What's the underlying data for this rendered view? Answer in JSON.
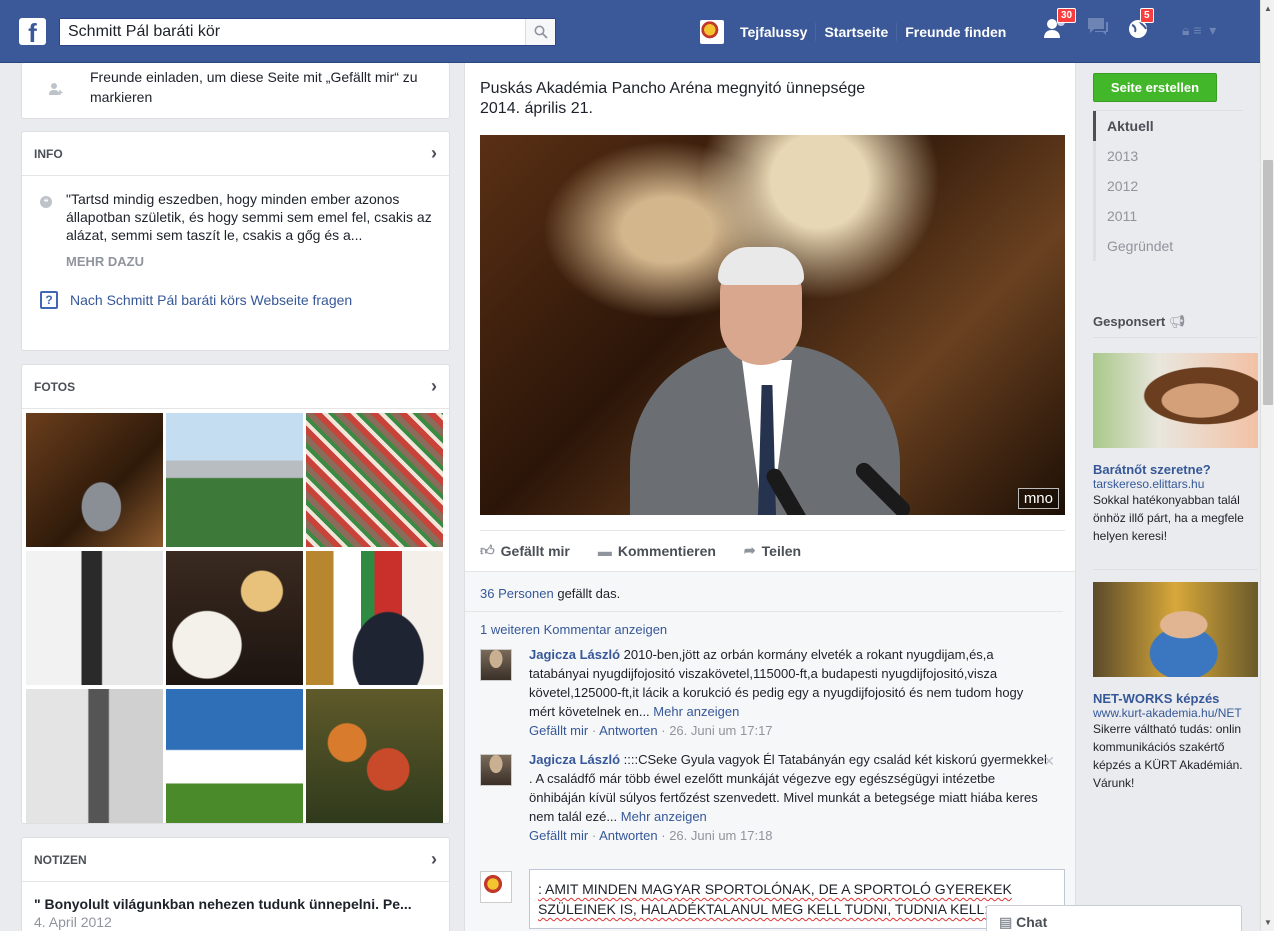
{
  "topbar": {
    "logo": "f",
    "search_value": "Schmitt Pál baráti kör",
    "user_name": "Tejfalussy",
    "nav": [
      "Startseite",
      "Freunde finden"
    ],
    "friend_requests_count": "30",
    "notifications_count": "5"
  },
  "invite": {
    "text": "Freunde einladen, um diese Seite mit „Gefällt mir“ zu markieren"
  },
  "info": {
    "header": "INFO",
    "quote": "\"Tartsd mindig eszedben, hogy minden ember azonos állapotban születik, és hogy semmi sem emel fel, csakis az alázat, semmi sem taszít le, csakis a gőg és a...",
    "more": "MEHR DAZU",
    "ask": "Nach Schmitt Pál baráti körs Webseite fragen"
  },
  "fotos": {
    "header": "FOTOS"
  },
  "notizen": {
    "header": "NOTIZEN",
    "title": "\" Bonyolult világunkban nehezen tudunk ünnepelni. Pe...",
    "date": "4. April 2012"
  },
  "post": {
    "text_line1": "Puskás Akadémia Pancho Aréna megnyitó ünnepsége",
    "text_line2": "2014. április 21.",
    "watermark": "mno",
    "actions": [
      "Gefällt mir",
      "Kommentieren",
      "Teilen"
    ],
    "likes_count": "36 Personen",
    "likes_suffix": " gefällt das.",
    "more_comments": "1 weiteren Kommentar anzeigen",
    "comments": [
      {
        "author": "Jagicza László",
        "text": " 2010-ben,jött az orbán kormány elveték a rokant nyugdijam,és,a tatabányai nyugdijfojositó viszakövetel,115000-ft,a budapesti nyugdijfojositó,visza követel,125000-ft,it lácik a korukció és pedig egy a nyugdijfojositó és nem tudom hogy mért követelnek en...",
        "more": "Mehr anzeigen",
        "like": "Gefällt mir",
        "reply": "Antworten",
        "time": "26. Juni um 17:17"
      },
      {
        "author": "Jagicza László",
        "text": " ::::CSeke Gyula vagyok Él Tatabányán egy család két kiskorú gyermekkel . A családfő már több éwel ezelőtt munkáját végezve egy egészségügyi intézetbe önhibáján kívül súlyos fertőzést szenvedett. Mivel munkát a betegsége miatt hiába keres nem talál ezé...",
        "more": "Mehr anzeigen",
        "like": "Gefällt mir",
        "reply": "Antworten",
        "time": "26. Juni um 17:18"
      }
    ],
    "reply_text": ": AMIT MINDEN MAGYAR SPORTOLÓNAK, DE A SPORTOLÓ GYEREKEK SZÜLEINEK IS, HALADÉKTALANUL MEG KELL TUDNI, TUDNIA KELL:"
  },
  "right": {
    "create_page": "Seite erstellen",
    "timeline": [
      "Aktuell",
      "2013",
      "2012",
      "2011",
      "Gegründet"
    ],
    "sponsored": "Gesponsert",
    "ads": [
      {
        "title": "Barátnőt szeretne?",
        "url": "tarskereso.elittars.hu",
        "desc": [
          "Sokkal hatékonyabban talál",
          "önhöz illő párt, ha a megfele",
          "helyen keresi!"
        ]
      },
      {
        "title": "NET-WORKS képzés",
        "url": "www.kurt-akademia.hu/NET",
        "desc": [
          "Sikerre váltható tudás: onlin",
          "kommunikációs szakértő",
          "képzés a KÜRT Akadémián.",
          "Várunk!"
        ]
      }
    ]
  },
  "chat": {
    "label": "Chat"
  }
}
